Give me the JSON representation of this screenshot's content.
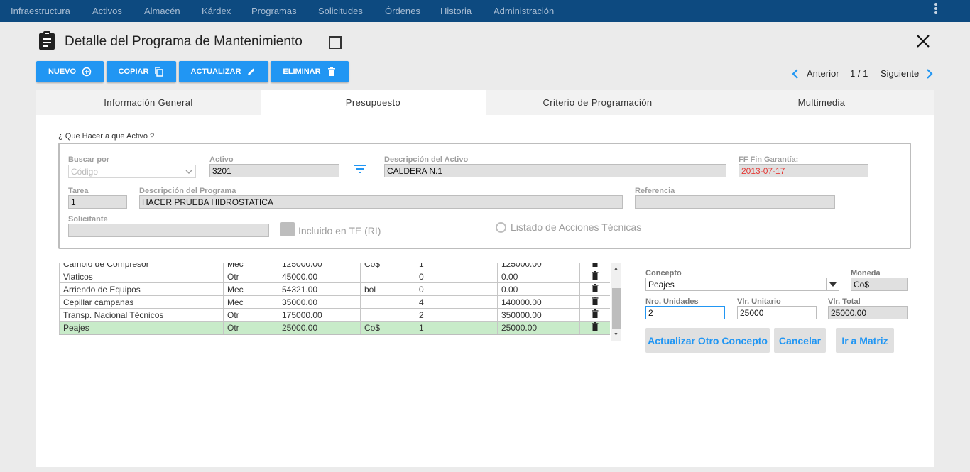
{
  "nav": {
    "items": [
      "Infraestructura",
      "Activos",
      "Almacén",
      "Kárdex",
      "Programas",
      "Solicitudes",
      "Órdenes",
      "Historia",
      "Administración"
    ]
  },
  "header": {
    "title": "Detalle del Programa de Mantenimiento"
  },
  "toolbar": {
    "nuevo": "NUEVO",
    "copiar": "COPIAR",
    "actualizar": "ACTUALIZAR",
    "eliminar": "ELIMINAR"
  },
  "pager": {
    "prev": "Anterior",
    "position": "1 / 1",
    "next": "Siguiente"
  },
  "tabs": [
    "Información General",
    "Presupuesto",
    "Criterio de Programación",
    "Multimedia"
  ],
  "form": {
    "legend": "¿ Que Hacer a que Activo ?",
    "buscar_por_label": "Buscar por",
    "buscar_por_value": "Código",
    "activo_label": "Activo",
    "activo_value": "3201",
    "desc_activo_label": "Descripción del Activo",
    "desc_activo_value": "CALDERA N.1",
    "ff_label": "FF Fin Garantía:",
    "ff_value": "2013-07-17",
    "tarea_label": "Tarea",
    "tarea_value": "1",
    "desc_programa_label": "Descripción del Programa",
    "desc_programa_value": "HACER PRUEBA HIDROSTATICA",
    "referencia_label": "Referencia",
    "referencia_value": "",
    "solicitante_label": "Solicitante",
    "solicitante_value": "",
    "incluido_label": "Incluido en TE (RI)",
    "listado_label": "Listado de Acciones Técnicas"
  },
  "table": {
    "rows": [
      [
        "Cambio de Compresor",
        "Mec",
        "125000.00",
        "Co$",
        "1",
        "125000.00"
      ],
      [
        "Viaticos",
        "Otr",
        "45000.00",
        "",
        "0",
        "0.00"
      ],
      [
        "Arriendo de Equipos",
        "Mec",
        "54321.00",
        "bol",
        "0",
        "0.00"
      ],
      [
        "Cepillar campanas",
        "Mec",
        "35000.00",
        "",
        "4",
        "140000.00"
      ],
      [
        "Transp. Nacional Técnicos",
        "Otr",
        "175000.00",
        "",
        "2",
        "350000.00"
      ],
      [
        "Peajes",
        "Otr",
        "25000.00",
        "Co$",
        "1",
        "25000.00"
      ]
    ]
  },
  "concepto": {
    "concepto_label": "Concepto",
    "concepto_value": "Peajes",
    "moneda_label": "Moneda",
    "moneda_value": "Co$",
    "unidades_label": "Nro. Unidades",
    "unidades_value": "2",
    "unitario_label": "Vlr. Unitario",
    "unitario_value": "25000",
    "total_label": "Vlr. Total",
    "total_value": "25000.00",
    "btn_actualizar": "Actualizar Otro Concepto",
    "btn_cancelar": "Cancelar",
    "btn_matriz": "Ir a Matriz"
  },
  "colors": {
    "nav_bg": "#0d4a80",
    "accent": "#2196f3",
    "selected_row": "#c8ebc9",
    "date_red": "#e53935"
  }
}
